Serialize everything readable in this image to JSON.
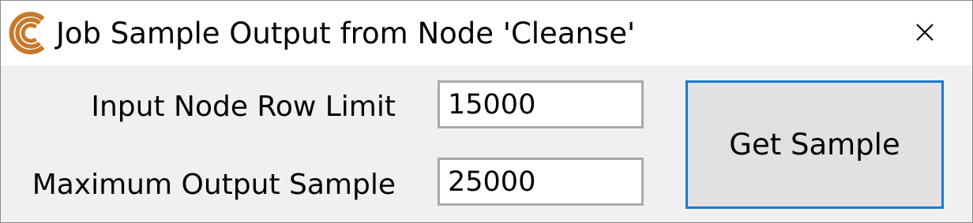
{
  "window": {
    "title": "Job Sample Output from Node 'Cleanse'",
    "app_icon": "c-logo-icon",
    "close_icon": "close-icon"
  },
  "form": {
    "row_limit_label": "Input Node Row Limit",
    "row_limit_value": "15000",
    "max_sample_label": "Maximum Output Sample",
    "max_sample_value": "25000",
    "get_sample_label": "Get Sample"
  },
  "colors": {
    "logo": "#c8782a",
    "button_focus_border": "#1b78d4",
    "button_background": "#e1e1e1",
    "window_background": "#f0f0f0",
    "input_border": "#a9a9a9"
  }
}
